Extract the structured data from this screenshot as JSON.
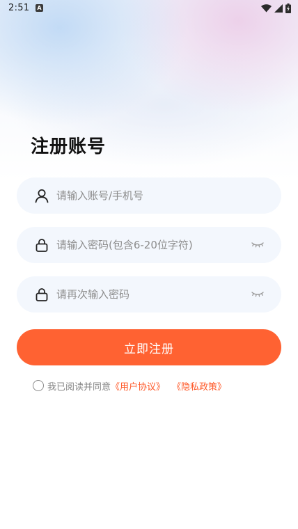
{
  "status_bar": {
    "time": "2:51",
    "notification_icon": "a-badge-icon",
    "icons": [
      "wifi-icon",
      "signal-icon",
      "battery-charging-icon"
    ]
  },
  "page": {
    "title": "注册账号"
  },
  "form": {
    "account_placeholder": "请输入账号/手机号",
    "password_placeholder": "请输入密码(包含6-20位字符)",
    "confirm_placeholder": "请再次输入密码",
    "account_icon": "user-icon",
    "password_icon": "lock-icon",
    "visibility_icon": "eye-closed-icon"
  },
  "register_button": {
    "label": "立即注册",
    "color": "#ff6232"
  },
  "agreement": {
    "text": "我已阅读并同意",
    "user_agreement": "《用户协议》",
    "privacy_policy": "《隐私政策》",
    "link_color": "#ff5a2a",
    "checked": false
  }
}
